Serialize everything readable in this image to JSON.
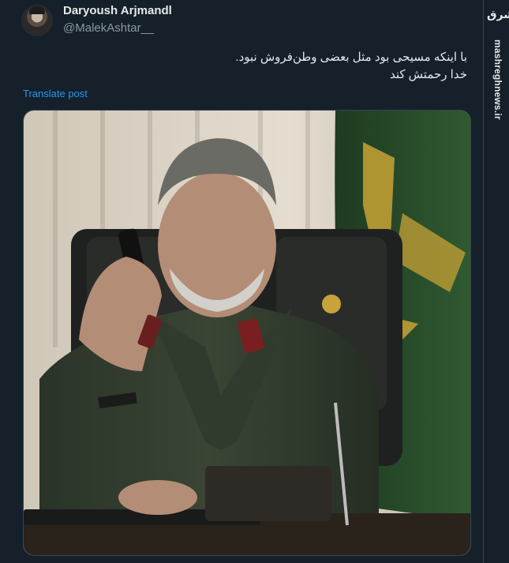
{
  "post": {
    "author_name": "Daryoush Arjmandl",
    "author_handle": "@MalekAshtar__",
    "text_lines": [
      "با اینکه مسیحی بود مثل بعضی  وطن‌فروش نبود.",
      "خدا رحمتش کند"
    ],
    "translate_label": "Translate post"
  },
  "media": {
    "nameplate_text": "..."
  },
  "watermark": {
    "logo_text": "مشرق",
    "site": "mashreghnews.ir"
  }
}
